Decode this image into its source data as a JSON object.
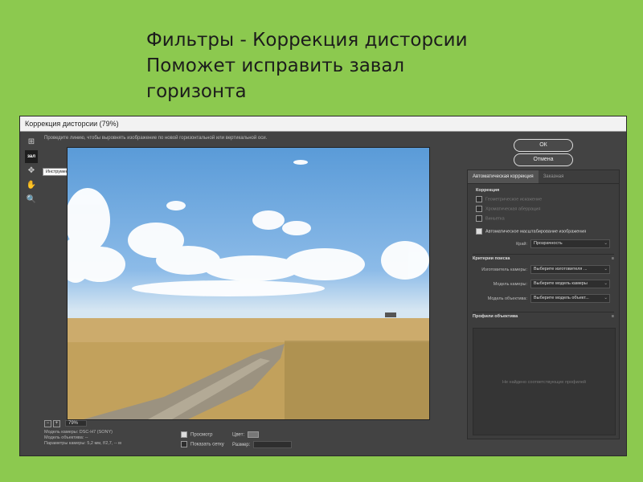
{
  "slide": {
    "title_line1": "Фильтры - Коррекция дисторсии",
    "title_line2": "Поможет исправить завал",
    "title_line3": "горизонта"
  },
  "dialog": {
    "title": "Коррекция дисторсии (79%)",
    "hint": "Проведите линию, чтобы выровнять изображение по новой горизонтальной или вертикальной оси.",
    "tools": [
      {
        "icon": "remove-distortion-icon",
        "glyph": "⊞"
      },
      {
        "icon": "straighten-icon",
        "glyph": "зал"
      },
      {
        "icon": "move-grid-icon",
        "glyph": "✥"
      },
      {
        "icon": "hand-icon",
        "glyph": "✋"
      },
      {
        "icon": "zoom-icon",
        "glyph": "🔍"
      }
    ],
    "tooltip": "Инструмент \"Выпрямление\" (A)",
    "zoom": {
      "minus": "−",
      "plus": "+",
      "value": "79%"
    },
    "camera_info": {
      "line1": "Модель камеры: DSC-H7 (SONY)",
      "line2": "Модель объектива: --",
      "line3": "Параметры камеры: 5,2 мм, f/2,7, -- м"
    },
    "preview_label": "Просмотр",
    "show_grid_label": "Показать сетку",
    "color_label": "Цвет:",
    "size_label": "Размер:",
    "ok_label": "ОК",
    "cancel_label": "Отмена",
    "tabs": [
      "Автоматическая коррекция",
      "Заказная"
    ],
    "correction_label": "Коррекция",
    "options": [
      "Геометрическое искажение",
      "Хроматическая аберрация",
      "Виньетка"
    ],
    "auto_scale_label": "Автоматическое масштабирование изображения",
    "edge_label": "Край:",
    "edge_value": "Прозрачность",
    "search_criteria_label": "Критерии поиска",
    "camera_maker_label": "Изготовитель камеры:",
    "camera_maker_value": "Выберите изготовителя ...",
    "camera_model_label": "Модель камеры:",
    "camera_model_value": "Выберите модель камеры",
    "lens_model_label": "Модель объектива:",
    "lens_model_value": "Выберите модель объект...",
    "lens_profiles_label": "Профили объектива",
    "no_profiles_text": "Не найдено соответствующих профилей",
    "menu_glyph": "≡"
  }
}
